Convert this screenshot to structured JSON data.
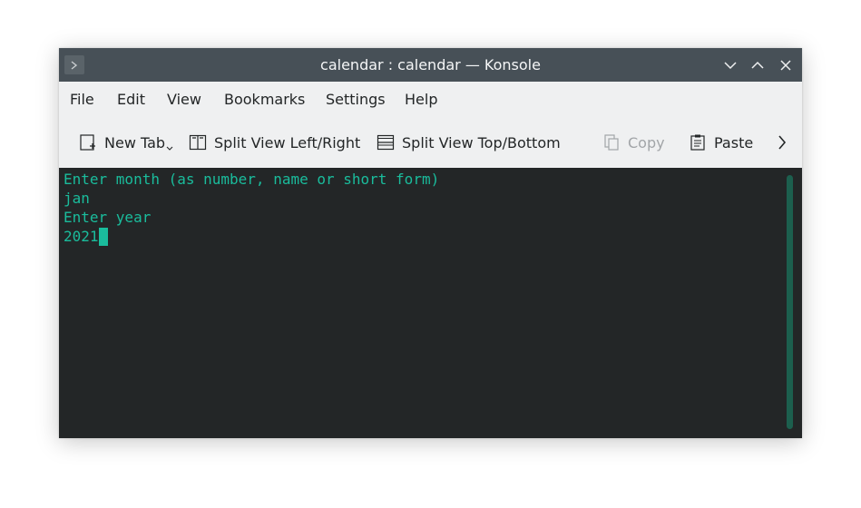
{
  "window": {
    "title": "calendar : calendar — Konsole"
  },
  "menubar": {
    "items": [
      {
        "label": "File"
      },
      {
        "label": "Edit"
      },
      {
        "label": "View"
      },
      {
        "label": "Bookmarks"
      },
      {
        "label": "Settings"
      },
      {
        "label": "Help"
      }
    ]
  },
  "toolbar": {
    "new_tab": "New Tab",
    "split_lr": "Split View Left/Right",
    "split_tb": "Split View Top/Bottom",
    "copy": "Copy",
    "paste": "Paste"
  },
  "terminal": {
    "lines": [
      "Enter month (as number, name or short form)",
      "jan",
      "Enter year",
      "2021"
    ],
    "text_color": "#1abc9c",
    "background": "#232627"
  },
  "colors": {
    "titlebar": "#475057",
    "chrome": "#eff0f1",
    "accent": "#1abc9c"
  }
}
